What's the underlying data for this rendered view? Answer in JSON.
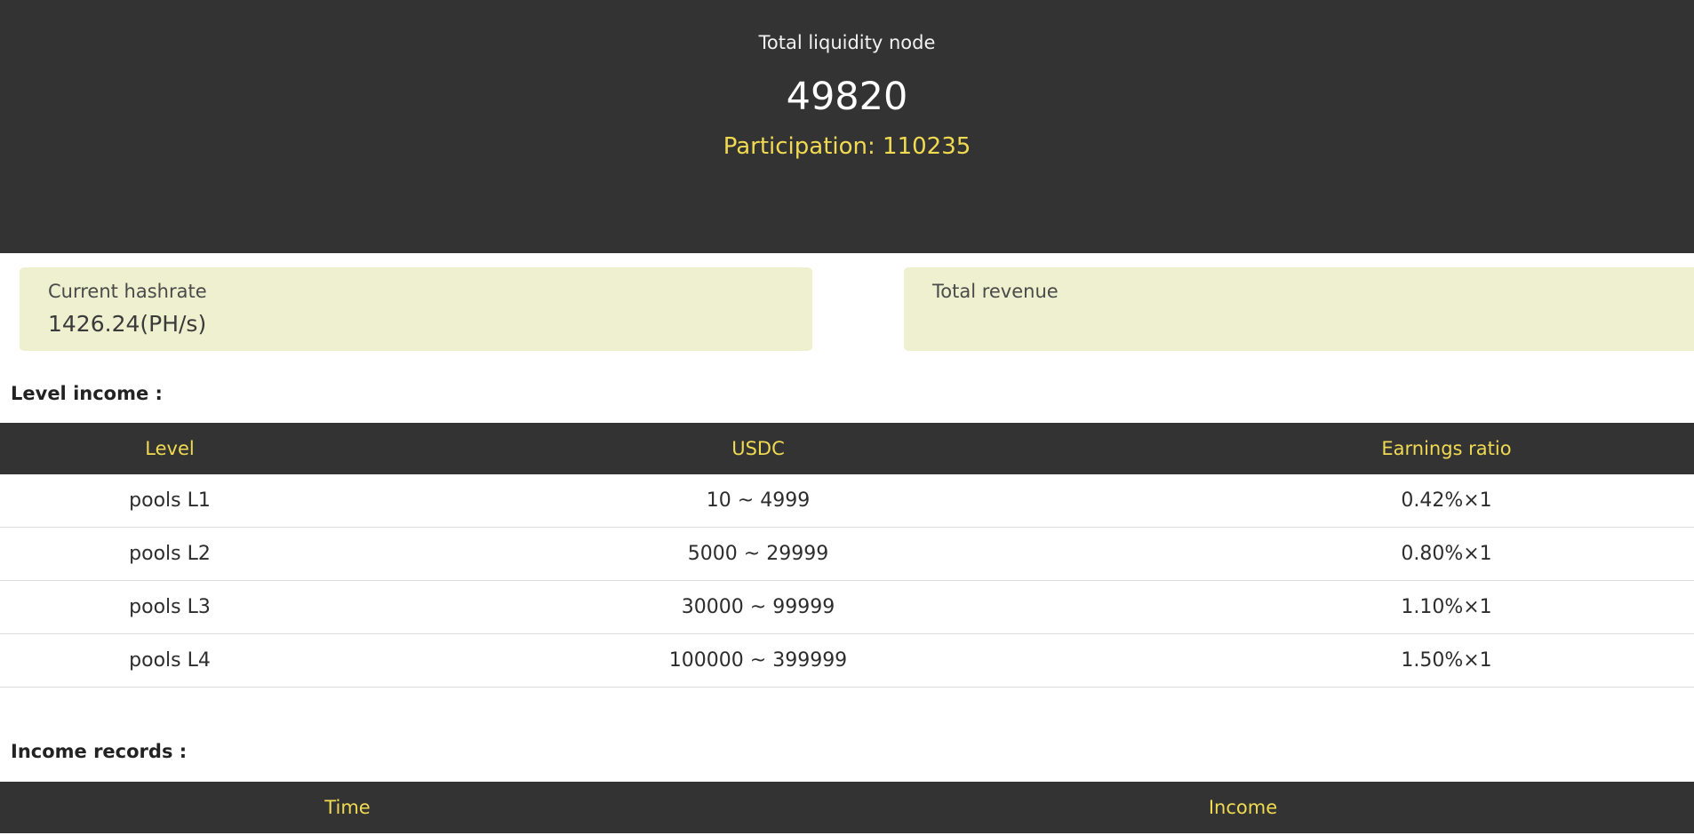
{
  "summary": {
    "label": "Total liquidity node",
    "value": "49820",
    "participation": "Participation: 110235"
  },
  "cards": {
    "hashrate": {
      "label": "Current hashrate",
      "value": "1426.24(PH/s)"
    },
    "revenue": {
      "label": "Total revenue",
      "value": ""
    }
  },
  "level_income": {
    "title": "Level income :",
    "columns": [
      "Level",
      "USDC",
      "Earnings ratio"
    ],
    "rows": [
      {
        "level": "pools L1",
        "usdc": "10 ~ 4999",
        "ratio": "0.42%×1"
      },
      {
        "level": "pools L2",
        "usdc": "5000 ~ 29999",
        "ratio": "0.80%×1"
      },
      {
        "level": "pools L3",
        "usdc": "30000 ~ 99999",
        "ratio": "1.10%×1"
      },
      {
        "level": "pools L4",
        "usdc": "100000 ~ 399999",
        "ratio": "1.50%×1"
      }
    ]
  },
  "income_records": {
    "title": "Income records :",
    "columns": [
      "Time",
      "Income"
    ]
  },
  "colors": {
    "dark_bg": "#333333",
    "accent": "#f0da52",
    "card_bg": "#eff0cf"
  }
}
